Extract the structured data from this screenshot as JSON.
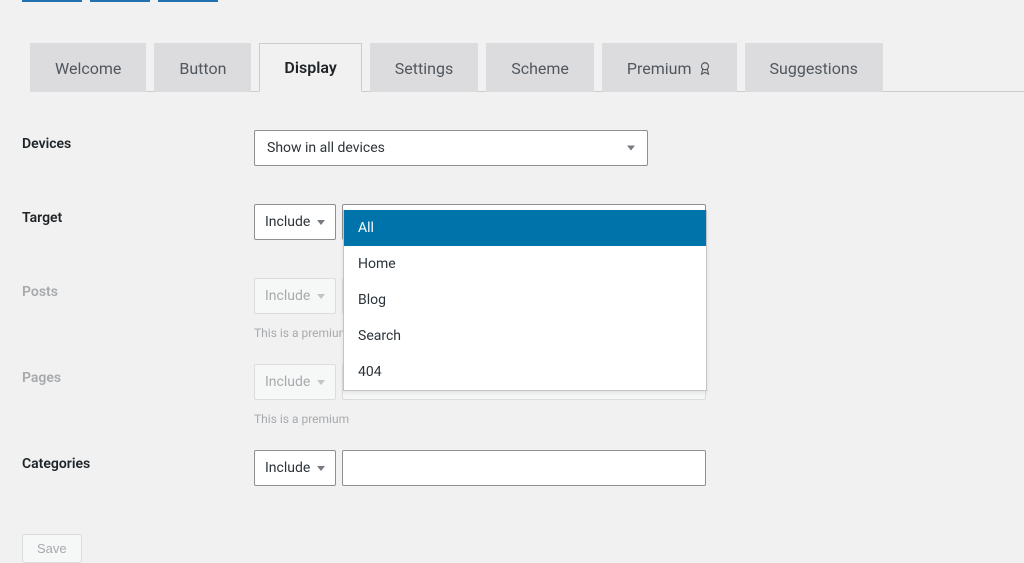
{
  "tabs": [
    {
      "label": "Welcome"
    },
    {
      "label": "Button"
    },
    {
      "label": "Display"
    },
    {
      "label": "Settings"
    },
    {
      "label": "Scheme"
    },
    {
      "label": "Premium"
    },
    {
      "label": "Suggestions"
    }
  ],
  "fields": {
    "devices": {
      "label": "Devices",
      "value": "Show in all devices"
    },
    "target": {
      "label": "Target",
      "include": "Include"
    },
    "posts": {
      "label": "Posts",
      "include": "Include",
      "note": "This is a premium"
    },
    "pages": {
      "label": "Pages",
      "include": "Include",
      "note": "This is a premium"
    },
    "categories": {
      "label": "Categories",
      "include": "Include"
    }
  },
  "target_options": [
    {
      "label": "All",
      "highlighted": true
    },
    {
      "label": "Home"
    },
    {
      "label": "Blog"
    },
    {
      "label": "Search"
    },
    {
      "label": "404"
    }
  ],
  "save_label": "Save"
}
